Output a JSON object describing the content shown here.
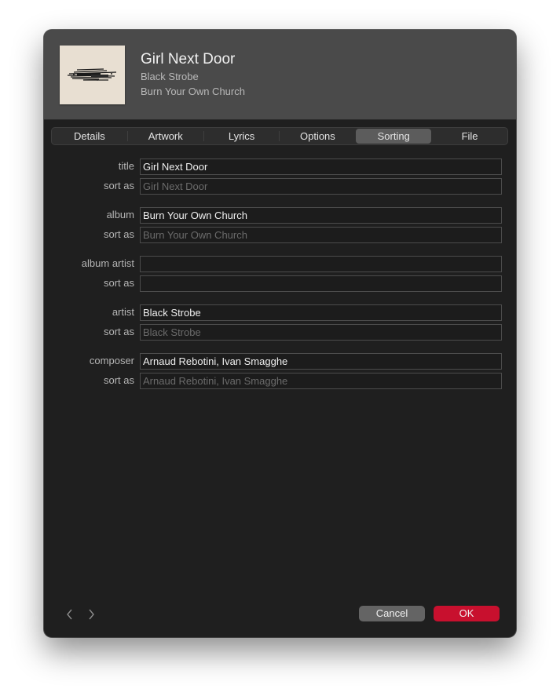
{
  "header": {
    "title": "Girl Next Door",
    "artist": "Black Strobe",
    "album": "Burn Your Own Church"
  },
  "tabs": [
    {
      "label": "Details",
      "active": false
    },
    {
      "label": "Artwork",
      "active": false
    },
    {
      "label": "Lyrics",
      "active": false
    },
    {
      "label": "Options",
      "active": false
    },
    {
      "label": "Sorting",
      "active": true
    },
    {
      "label": "File",
      "active": false
    }
  ],
  "form": {
    "title": {
      "label": "title",
      "value": ""
    },
    "title_value": "Girl Next Door",
    "title_sort": {
      "label": "sort as",
      "placeholder": "Girl Next Door"
    },
    "album": {
      "label": "album",
      "value": "Burn Your Own Church"
    },
    "album_sort": {
      "label": "sort as",
      "placeholder": "Burn Your Own Church"
    },
    "album_artist": {
      "label": "album artist",
      "value": ""
    },
    "album_artist_sort": {
      "label": "sort as",
      "placeholder": ""
    },
    "artist": {
      "label": "artist",
      "value": "Black Strobe"
    },
    "artist_sort": {
      "label": "sort as",
      "placeholder": "Black Strobe"
    },
    "composer": {
      "label": "composer",
      "value": "Arnaud Rebotini, Ivan Smagghe"
    },
    "composer_sort": {
      "label": "sort as",
      "placeholder": "Arnaud Rebotini, Ivan Smagghe"
    }
  },
  "footer": {
    "prev_icon": "chevron-left-icon",
    "next_icon": "chevron-right-icon",
    "cancel_label": "Cancel",
    "ok_label": "OK"
  },
  "colors": {
    "ok_button": "#c8102e",
    "active_tab": "#5c5c5c",
    "window_bg": "#1f1f1f"
  }
}
